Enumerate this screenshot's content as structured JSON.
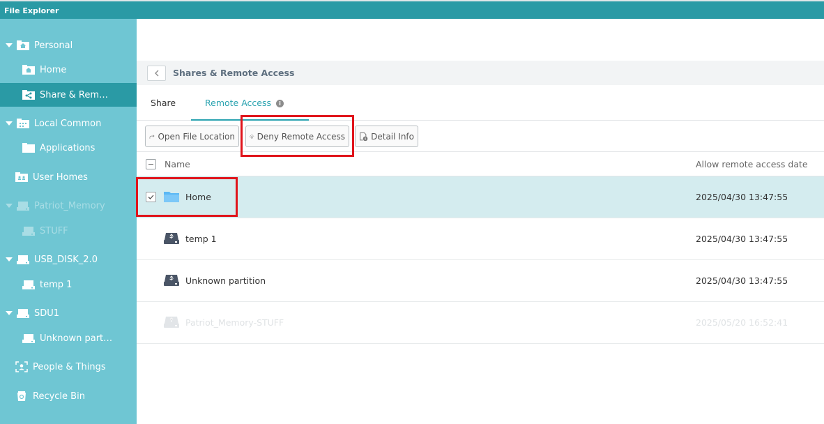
{
  "app": {
    "title": "File Explorer"
  },
  "sidebar": {
    "items": [
      {
        "label": "Personal"
      },
      {
        "label": "Home"
      },
      {
        "label": "Share & Remote Access"
      },
      {
        "label": "Local Common"
      },
      {
        "label": "Applications"
      },
      {
        "label": "User Homes"
      },
      {
        "label": "Patriot_Memory"
      },
      {
        "label": "STUFF"
      },
      {
        "label": "USB_DISK_2.0"
      },
      {
        "label": "temp 1"
      },
      {
        "label": "SDU1"
      },
      {
        "label": "Unknown partition"
      },
      {
        "label": "People & Things"
      },
      {
        "label": "Recycle Bin"
      }
    ]
  },
  "header": {
    "title": "Shares & Remote Access",
    "back_label": "<"
  },
  "tabs": [
    {
      "label": "Share"
    },
    {
      "label": "Remote Access"
    }
  ],
  "tab_info_glyph": "i",
  "toolbar": {
    "open_location": "Open File Location",
    "deny_remote": "Deny Remote Access",
    "detail_info": "Detail Info"
  },
  "table": {
    "columns": {
      "name": "Name",
      "date": "Allow remote access date"
    },
    "rows": [
      {
        "name": "Home",
        "date": "2025/04/30 13:47:55",
        "icon": "folder-icon",
        "selected": true
      },
      {
        "name": "temp 1",
        "date": "2025/04/30 13:47:55",
        "icon": "usb-drive-icon",
        "selected": false
      },
      {
        "name": "Unknown partition",
        "date": "2025/04/30 13:47:55",
        "icon": "usb-drive-icon",
        "selected": false
      },
      {
        "name": "Patriot_Memory-STUFF",
        "date": "2025/05/20 16:52:41",
        "icon": "usb-drive-icon",
        "selected": false,
        "disabled": true
      }
    ]
  },
  "colors": {
    "accent": "#2aa3b0",
    "sidebar": "#6fc6d3",
    "highlight": "#e0141b"
  }
}
